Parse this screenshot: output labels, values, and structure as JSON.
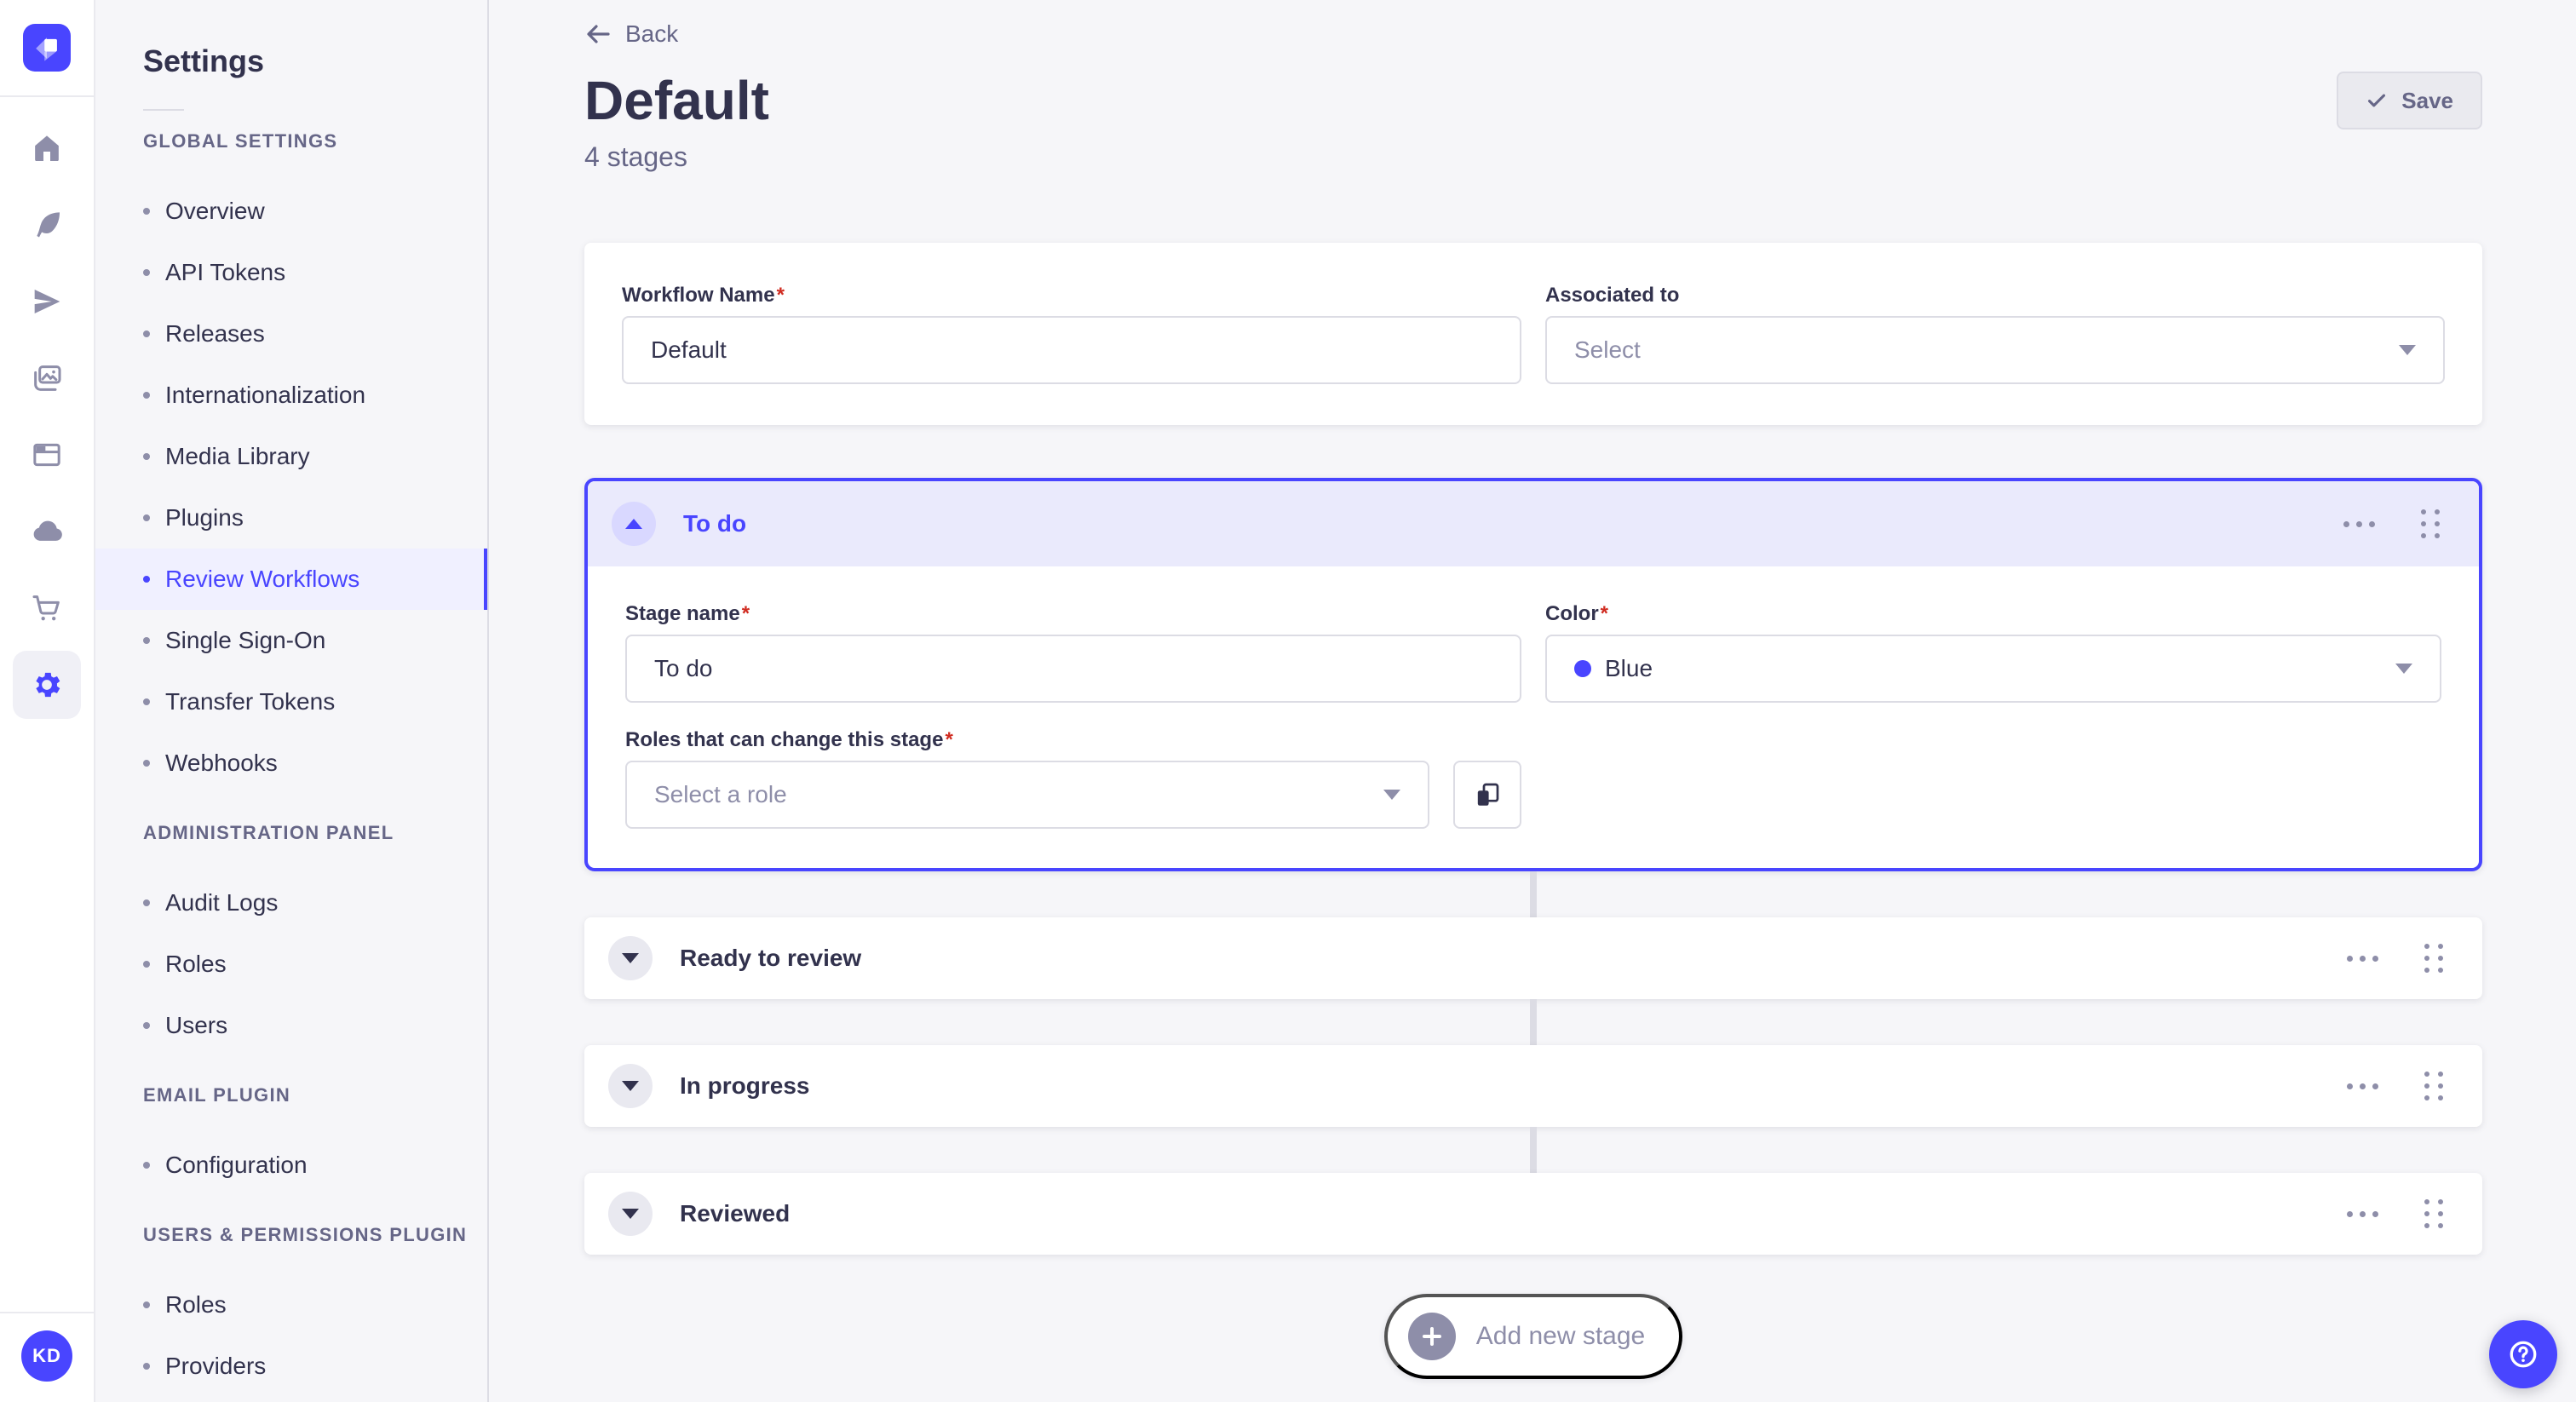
{
  "required_mark": "*",
  "colors": {
    "primary": "#4945ff",
    "danger": "#d02b20",
    "stage_header_bg": "#eaeafc",
    "selected_bg": "#f0f0ff"
  },
  "rail": {
    "logo": "strapi-logo",
    "user_initials": "KD",
    "icons": [
      "home",
      "content-type-builder",
      "deploy",
      "media-library",
      "content-manager",
      "cloud",
      "marketplace",
      "settings"
    ]
  },
  "subnav": {
    "title": "Settings",
    "sections": [
      {
        "label": "GLOBAL SETTINGS",
        "items": [
          {
            "label": "Overview"
          },
          {
            "label": "API Tokens"
          },
          {
            "label": "Releases"
          },
          {
            "label": "Internationalization"
          },
          {
            "label": "Media Library"
          },
          {
            "label": "Plugins"
          },
          {
            "label": "Review Workflows",
            "active": true
          },
          {
            "label": "Single Sign-On"
          },
          {
            "label": "Transfer Tokens"
          },
          {
            "label": "Webhooks"
          }
        ]
      },
      {
        "label": "ADMINISTRATION PANEL",
        "items": [
          {
            "label": "Audit Logs"
          },
          {
            "label": "Roles"
          },
          {
            "label": "Users"
          }
        ]
      },
      {
        "label": "EMAIL PLUGIN",
        "items": [
          {
            "label": "Configuration"
          }
        ]
      },
      {
        "label": "USERS & PERMISSIONS PLUGIN",
        "items": [
          {
            "label": "Roles"
          },
          {
            "label": "Providers"
          }
        ]
      }
    ]
  },
  "header": {
    "back": "Back",
    "title": "Default",
    "subtitle": "4 stages",
    "save": "Save"
  },
  "workflow_form": {
    "name_label": "Workflow Name",
    "name_value": "Default",
    "associated_label": "Associated to",
    "associated_placeholder": "Select"
  },
  "expanded_stage": {
    "title": "To do",
    "stage_name_label": "Stage name",
    "stage_name_value": "To do",
    "color_label": "Color",
    "color_value": "Blue",
    "color_hex": "#4945ff",
    "roles_label": "Roles that can change this stage",
    "roles_placeholder": "Select a role"
  },
  "collapsed_stages": [
    {
      "title": "Ready to review"
    },
    {
      "title": "In progress"
    },
    {
      "title": "Reviewed"
    }
  ],
  "add_stage_label": "Add new stage"
}
